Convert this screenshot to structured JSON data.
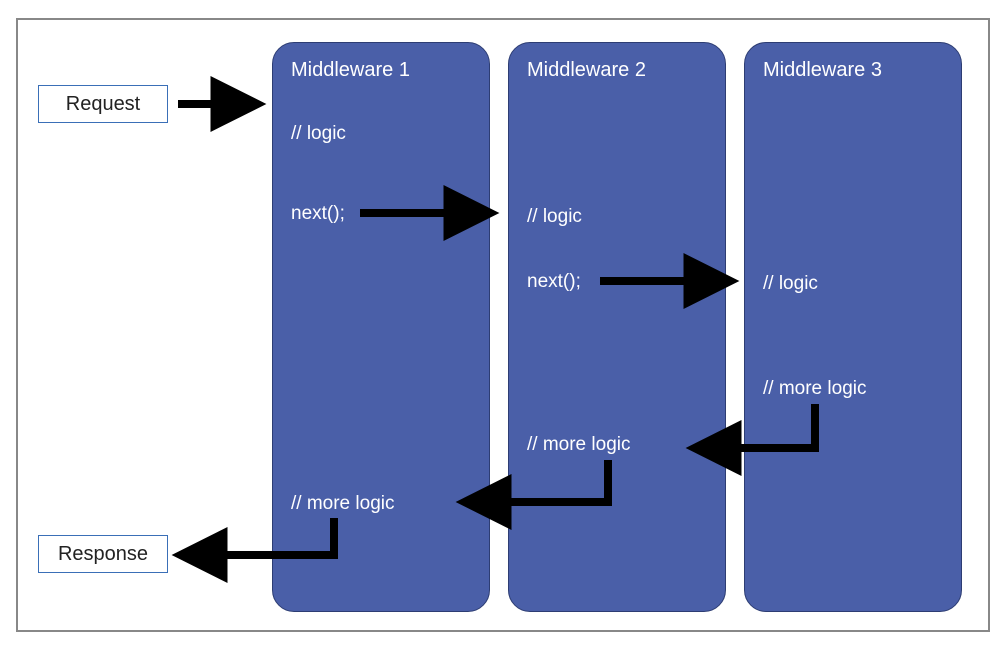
{
  "io": {
    "request": "Request",
    "response": "Response"
  },
  "middlewares": [
    {
      "title": "Middleware 1",
      "lines": {
        "logic": "// logic",
        "next": "next();",
        "more": "// more logic"
      }
    },
    {
      "title": "Middleware 2",
      "lines": {
        "logic": "// logic",
        "next": "next();",
        "more": "// more logic"
      }
    },
    {
      "title": "Middleware 3",
      "lines": {
        "logic": "// logic",
        "more": "// more logic"
      }
    }
  ]
}
